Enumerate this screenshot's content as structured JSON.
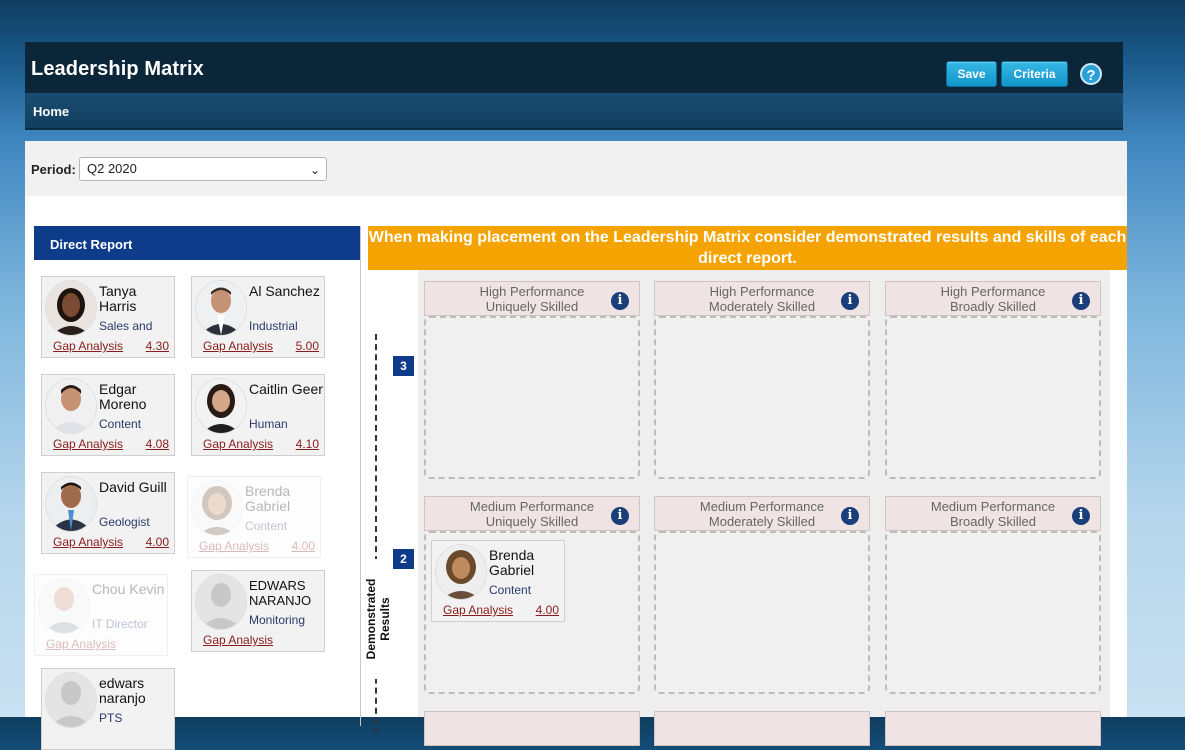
{
  "app": {
    "title": "Leadership Matrix",
    "save_label": "Save",
    "criteria_label": "Criteria",
    "help_label": "?"
  },
  "nav": {
    "home": "Home"
  },
  "period": {
    "label": "Period:",
    "selected": "Q2 2020"
  },
  "direct_report": {
    "title": "Direct Report",
    "cards": [
      {
        "name": "Tanya Harris",
        "role": "Sales and",
        "gap": "Gap Analysis",
        "score": "4.30"
      },
      {
        "name": "Al Sanchez",
        "role": "Industrial",
        "gap": "Gap Analysis",
        "score": "5.00"
      },
      {
        "name": "Edgar Moreno",
        "role": "Content",
        "gap": "Gap Analysis",
        "score": "4.08"
      },
      {
        "name": "Caitlin Geer",
        "role": "Human",
        "gap": "Gap Analysis",
        "score": "4.10"
      },
      {
        "name": "David Guill",
        "role": "Geologist",
        "gap": "Gap Analysis",
        "score": "4.00"
      },
      {
        "name": "Brenda Gabriel",
        "role": "Content",
        "gap": "Gap Analysis",
        "score": "4.00"
      },
      {
        "name": "Chou Kevin",
        "role": "IT Director",
        "gap": "Gap Analysis",
        "score": ""
      },
      {
        "name": "EDWARS NARANJO",
        "role": "Monitoring",
        "gap": "Gap Analysis",
        "score": ""
      },
      {
        "name": "edwars naranjo",
        "role": "PTS",
        "gap": "",
        "score": ""
      }
    ]
  },
  "banner": "When making placement on the Leadership Matrix consider demonstrated results and skills of each direct report.",
  "matrix": {
    "axis_label": "Demonstrated Results",
    "rows": [
      {
        "number": "3",
        "cells": [
          {
            "title": "High Performance",
            "subtitle": "Uniquely Skilled"
          },
          {
            "title": "High Performance",
            "subtitle": "Moderately Skilled"
          },
          {
            "title": "High Performance",
            "subtitle": "Broadly Skilled"
          }
        ]
      },
      {
        "number": "2",
        "cells": [
          {
            "title": "Medium Performance",
            "subtitle": "Uniquely Skilled"
          },
          {
            "title": "Medium Performance",
            "subtitle": "Moderately Skilled"
          },
          {
            "title": "Medium Performance",
            "subtitle": "Broadly Skilled"
          }
        ]
      }
    ],
    "placed": {
      "name": "Brenda Gabriel",
      "role": "Content",
      "gap": "Gap Analysis",
      "score": "4.00"
    },
    "info_icon": "i"
  },
  "icons": [
    "help-icon",
    "chevron-down-icon",
    "info-icon",
    "avatar-icon"
  ],
  "colors": {
    "titlebar": "#0a2638",
    "nav": "#1a4d73",
    "header_blue": "#0f3c8a",
    "banner": "#f5a300",
    "link": "#8a1c1c"
  }
}
